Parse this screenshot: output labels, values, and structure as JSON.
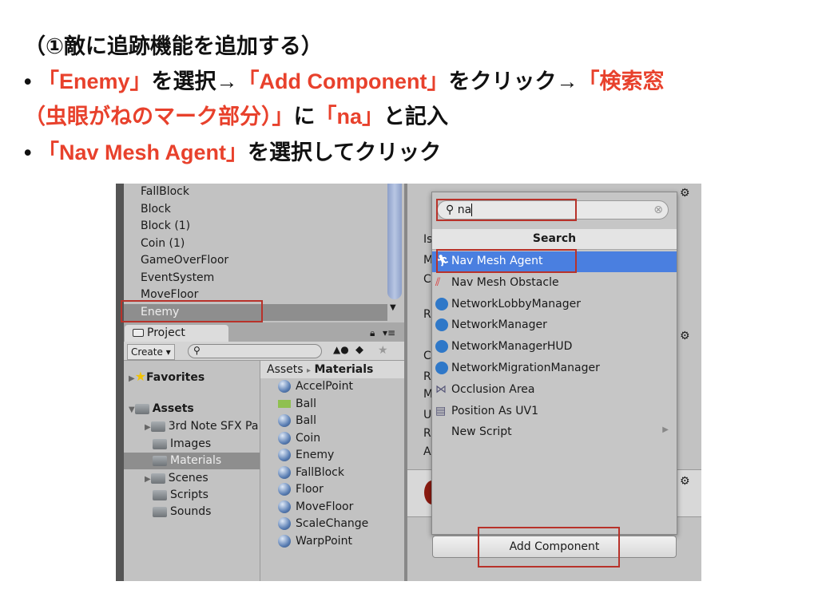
{
  "slide": {
    "title": "（①敵に追跡機能を追加する）",
    "bullet1": {
      "p1": "「Enemy」",
      "p2": "を選択→",
      "p3": "「Add Component」",
      "p4": "をクリック→",
      "p5": "「検索窓"
    },
    "bullet1b": {
      "p1": "（虫眼がねのマーク部分）」",
      "p2": "に",
      "p3": "「na」",
      "p4": "と記入"
    },
    "bullet2": {
      "p1": "「Nav Mesh Agent」",
      "p2": "を選択してクリック"
    },
    "bullet_mark": "•",
    "accent": "#e8412c"
  },
  "hierarchy": {
    "items": [
      "FallBlock",
      "Block",
      "Block (1)",
      "Coin (1)",
      "GameOverFloor",
      "EventSystem",
      "MoveFloor",
      "Enemy"
    ],
    "selected": "Enemy"
  },
  "project": {
    "tab": "Project",
    "create": "Create ▾",
    "tree": [
      {
        "label": "Favorites",
        "bold": true,
        "arrow": "▶"
      },
      {
        "label": "Assets",
        "bold": true,
        "arrow": "▼"
      },
      {
        "label": "3rd Note SFX Pa",
        "arrow": "▶"
      },
      {
        "label": "Images"
      },
      {
        "label": "Materials",
        "selected": true
      },
      {
        "label": "Scenes",
        "arrow": "▶"
      },
      {
        "label": "Scripts"
      },
      {
        "label": "Sounds"
      }
    ],
    "breadcrumb": {
      "root": "Assets",
      "sep": "▸",
      "current": "Materials"
    },
    "assets": [
      "AccelPoint",
      "Ball",
      "Ball",
      "Coin",
      "Enemy",
      "FallBlock",
      "Floor",
      "MoveFloor",
      "ScaleChange",
      "WarpPoint"
    ]
  },
  "inspector": {
    "labels": [
      "Is",
      "M",
      "C",
      "R",
      "C",
      "R",
      "M",
      "U",
      "R",
      "A"
    ]
  },
  "popup": {
    "search_value": "na",
    "header": "Search",
    "items": [
      "Nav Mesh Agent",
      "Nav Mesh Obstacle",
      "NetworkLobbyManager",
      "NetworkManager",
      "NetworkManagerHUD",
      "NetworkMigrationManager",
      "Occlusion Area",
      "Position As UV1",
      "New Script"
    ],
    "highlight_color": "#4a7fe0"
  },
  "add_component": "Add Component"
}
